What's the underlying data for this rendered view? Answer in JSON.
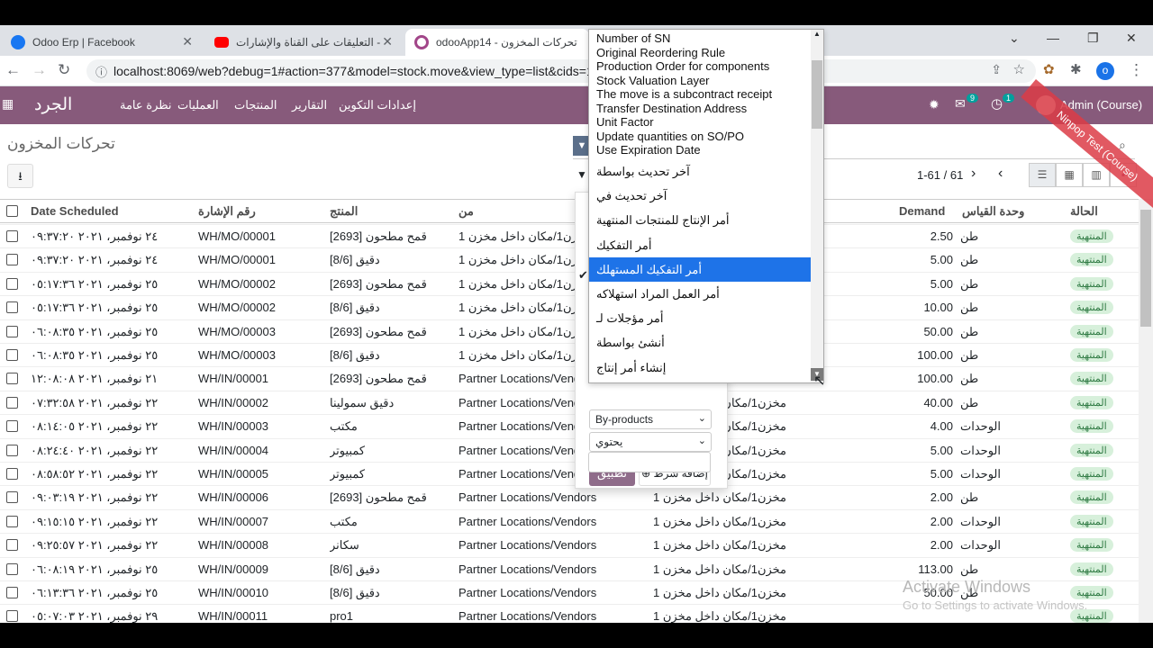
{
  "browser": {
    "tabs": [
      {
        "label": "Odoo Erp | Facebook",
        "icon": "facebook-icon",
        "color": "#1877f2"
      },
      {
        "label": "التعليقات على القناة والإشارات - ...",
        "icon": "youtube-icon",
        "color": "#ff0000"
      },
      {
        "label": "odooApp14 - تحركات المخزون",
        "icon": "odoo-icon",
        "color": "#a24689"
      }
    ],
    "url": "localhost:8069/web?debug=1#action=377&model=stock.move&view_type=list&cids=1&m",
    "profile_initial": "o"
  },
  "nav": {
    "brand": "الجرد",
    "menu": [
      "نظرة عامة",
      "العمليات",
      "المنتجات",
      "التقارير",
      "إعدادات التكوين"
    ],
    "messages_badge": "9",
    "activity_badge": "1",
    "user": "Admin (Course)"
  },
  "page": {
    "title": "تحركات المخزون",
    "pager": "1-61 / 61"
  },
  "table": {
    "headers": {
      "date": "Date Scheduled",
      "ref": "رقم الإشارة",
      "product": "المنتج",
      "from": "من",
      "demand": "Demand",
      "uom": "وحدة القياس",
      "state": "الحالة"
    },
    "rows": [
      {
        "date": "٢٤ نوفمبر، ٢٠٢١ ٠٩:٣٧:٢٠",
        "ref": "WH/MO/00001",
        "product": "قمح مطحون [2693]",
        "from": "مخزن1/مكان داخل مخزن 1",
        "to": "",
        "demand": "2.50",
        "uom": "طن",
        "state": "المنتهية"
      },
      {
        "date": "٢٤ نوفمبر، ٢٠٢١ ٠٩:٣٧:٢٠",
        "ref": "WH/MO/00001",
        "product": "دقيق [8/6]",
        "from": "مخزن1/مكان داخل مخزن 1",
        "to": "",
        "demand": "5.00",
        "uom": "طن",
        "state": "المنتهية"
      },
      {
        "date": "٢٥ نوفمبر، ٢٠٢١ ٠٥:١٧:٣٦",
        "ref": "WH/MO/00002",
        "product": "قمح مطحون [2693]",
        "from": "مخزن1/مكان داخل مخزن 1",
        "to": "",
        "demand": "5.00",
        "uom": "طن",
        "state": "المنتهية"
      },
      {
        "date": "٢٥ نوفمبر، ٢٠٢١ ٠٥:١٧:٣٦",
        "ref": "WH/MO/00002",
        "product": "دقيق [8/6]",
        "from": "مخزن1/مكان داخل مخزن 1",
        "to": "",
        "demand": "10.00",
        "uom": "طن",
        "state": "المنتهية"
      },
      {
        "date": "٢٥ نوفمبر، ٢٠٢١ ٠٦:٠٨:٣٥",
        "ref": "WH/MO/00003",
        "product": "قمح مطحون [2693]",
        "from": "مخزن1/مكان داخل مخزن 1",
        "to": "",
        "demand": "50.00",
        "uom": "طن",
        "state": "المنتهية"
      },
      {
        "date": "٢٥ نوفمبر، ٢٠٢١ ٠٦:٠٨:٣٥",
        "ref": "WH/MO/00003",
        "product": "دقيق [8/6]",
        "from": "مخزن1/مكان داخل مخزن 1",
        "to": "",
        "demand": "100.00",
        "uom": "طن",
        "state": "المنتهية"
      },
      {
        "date": "٢١ نوفمبر، ٢٠٢١ ١٢:٠٨:٠٨",
        "ref": "WH/IN/00001",
        "product": "قمح مطحون [2693]",
        "from": "Partner Locations/Vendors",
        "to": "",
        "demand": "100.00",
        "uom": "طن",
        "state": "المنتهية"
      },
      {
        "date": "٢٢ نوفمبر، ٢٠٢١ ٠٧:٣٢:٥٨",
        "ref": "WH/IN/00002",
        "product": "دقيق سمولينا",
        "from": "Partner Locations/Vendors",
        "to": "مخزن1/مكان داخل مخزن 1",
        "demand": "40.00",
        "uom": "طن",
        "state": "المنتهية"
      },
      {
        "date": "٢٢ نوفمبر، ٢٠٢١ ٠٨:١٤:٠٥",
        "ref": "WH/IN/00003",
        "product": "مكتب",
        "from": "Partner Locations/Vendors",
        "to": "مخزن1/مكان داخل مخزن 1",
        "demand": "4.00",
        "uom": "الوحدات",
        "state": "المنتهية"
      },
      {
        "date": "٢٢ نوفمبر، ٢٠٢١ ٠٨:٢٤:٤٠",
        "ref": "WH/IN/00004",
        "product": "كمبيوتر",
        "from": "Partner Locations/Vendors",
        "to": "مخزن1/مكان داخل مخزن 1",
        "demand": "5.00",
        "uom": "الوحدات",
        "state": "المنتهية"
      },
      {
        "date": "٢٢ نوفمبر، ٢٠٢١ ٠٨:٥٨:٥٢",
        "ref": "WH/IN/00005",
        "product": "كمبيوتر",
        "from": "Partner Locations/Vendors",
        "to": "مخزن1/مكان داخل مخزن 1",
        "demand": "5.00",
        "uom": "الوحدات",
        "state": "المنتهية"
      },
      {
        "date": "٢٢ نوفمبر، ٢٠٢١ ٠٩:٠٣:١٩",
        "ref": "WH/IN/00006",
        "product": "قمح مطحون [2693]",
        "from": "Partner Locations/Vendors",
        "to": "مخزن1/مكان داخل مخزن 1",
        "demand": "2.00",
        "uom": "طن",
        "state": "المنتهية"
      },
      {
        "date": "٢٢ نوفمبر، ٢٠٢١ ٠٩:١٥:١٥",
        "ref": "WH/IN/00007",
        "product": "مكتب",
        "from": "Partner Locations/Vendors",
        "to": "مخزن1/مكان داخل مخزن 1",
        "demand": "2.00",
        "uom": "الوحدات",
        "state": "المنتهية"
      },
      {
        "date": "٢٢ نوفمبر، ٢٠٢١ ٠٩:٢٥:٥٧",
        "ref": "WH/IN/00008",
        "product": "سكانر",
        "from": "Partner Locations/Vendors",
        "to": "مخزن1/مكان داخل مخزن 1",
        "demand": "2.00",
        "uom": "الوحدات",
        "state": "المنتهية"
      },
      {
        "date": "٢٥ نوفمبر، ٢٠٢١ ٠٦:٠٨:١٩",
        "ref": "WH/IN/00009",
        "product": "دقيق [8/6]",
        "from": "Partner Locations/Vendors",
        "to": "مخزن1/مكان داخل مخزن 1",
        "demand": "113.00",
        "uom": "طن",
        "state": "المنتهية"
      },
      {
        "date": "٢٥ نوفمبر، ٢٠٢١ ٠٦:١٣:٣٦",
        "ref": "WH/IN/00010",
        "product": "دقيق [8/6]",
        "from": "Partner Locations/Vendors",
        "to": "مخزن1/مكان داخل مخزن 1",
        "demand": "50.00",
        "uom": "طن",
        "state": "المنتهية"
      },
      {
        "date": "٢٩ نوفمبر، ٢٠٢١ ٠٥:٠٧:٠٣",
        "ref": "WH/IN/00011",
        "product": "pro1",
        "from": "Partner Locations/Vendors",
        "to": "مخزن1/مكان داخل مخزن 1",
        "demand": "",
        "uom": "",
        "state": "المنتهية"
      }
    ]
  },
  "filter": {
    "field": "By-products",
    "operator": "يحتوي",
    "value": "",
    "apply": "تطبيق",
    "add": "إضافة شرط"
  },
  "dropdown": {
    "options": [
      "Number of SN",
      "Original Reordering Rule",
      "Production Order for components",
      "Stock Valuation Layer",
      "The move is a subcontract receipt",
      "Transfer Destination Address",
      "Unit Factor",
      "Update quantities on SO/PO",
      "Use Expiration Date",
      "آخر تحديث بواسطة",
      "آخر تحديث في",
      "أمر الإنتاج للمنتجات المنتهية",
      "أمر التفكيك",
      "أمر التفكيك المستهلك",
      "أمر العمل المراد استهلاكه",
      "أمر مؤجلات لـ",
      "أنشئ بواسطة",
      "إنشاء أمر إنتاج"
    ],
    "selected_index": 13
  },
  "watermark": {
    "line1": "Activate Windows",
    "line2": "Go to Settings to activate Windows.",
    "ribbon": "Ninpop Test (Course)"
  }
}
